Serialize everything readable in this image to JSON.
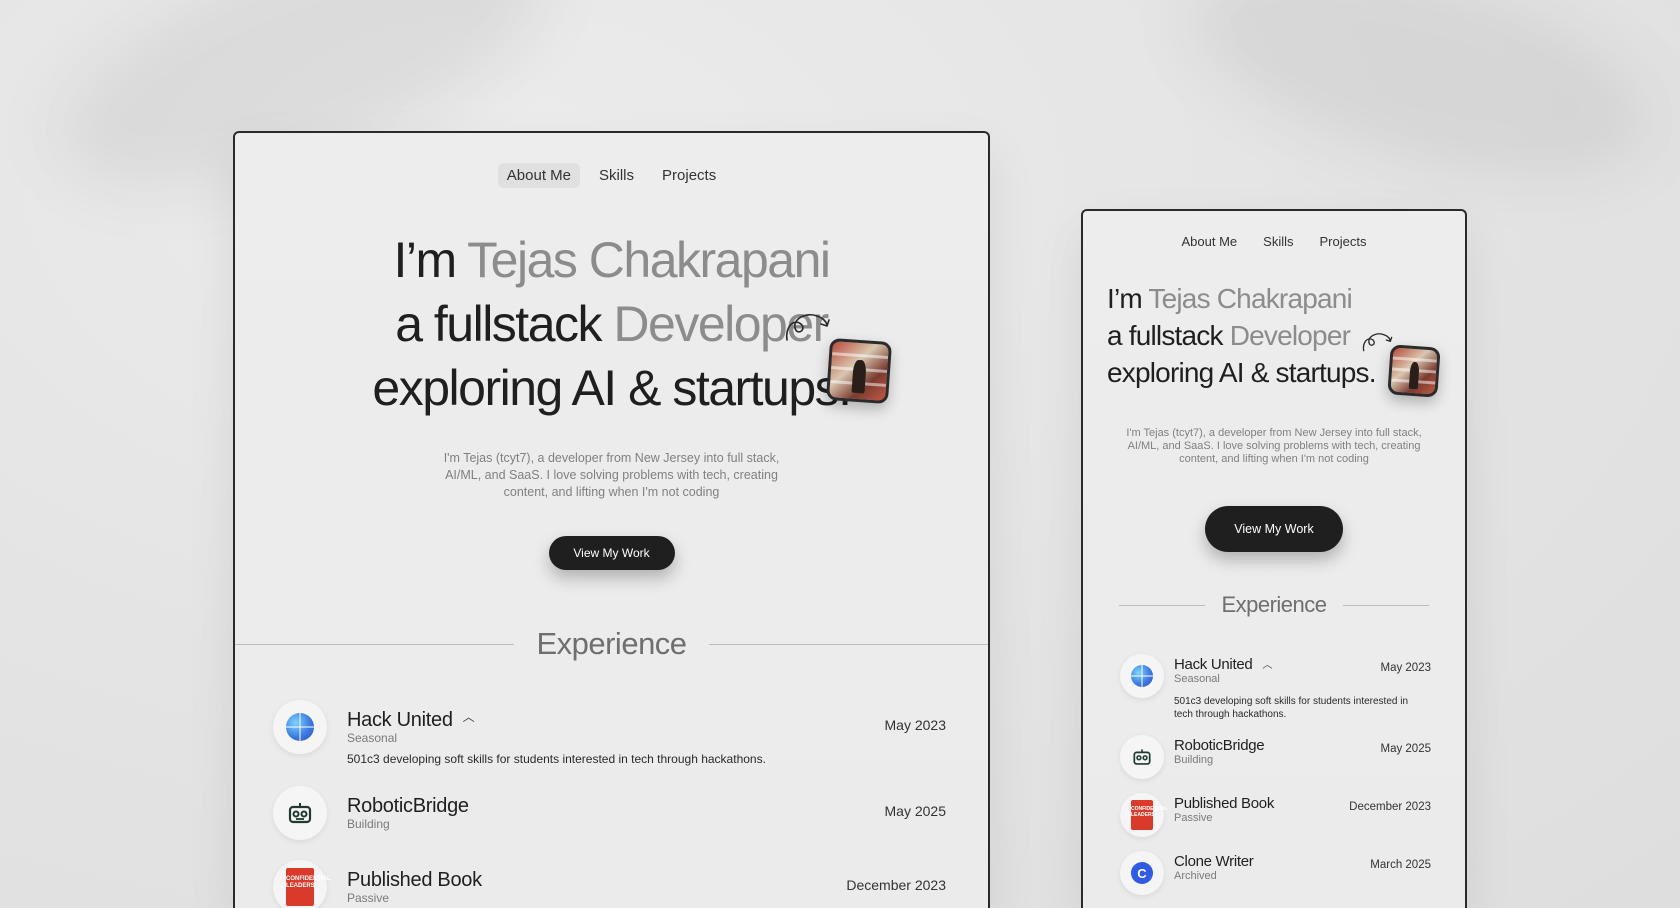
{
  "nav": [
    "About Me",
    "Skills",
    "Projects"
  ],
  "hero": {
    "line1_a": "I’m ",
    "line1_b": "Tejas Chakrapani",
    "line2_a": "a fullstack ",
    "line2_b": "Developer",
    "line3": "exploring AI & startups.",
    "bio": "I'm Tejas (tcyt7), a developer from New Jersey into full stack, AI/ML, and SaaS. I love solving problems with tech, creating content, and lifting when I'm not coding",
    "cta": "View My Work"
  },
  "experience": {
    "heading": "Experience",
    "items": [
      {
        "title": "Hack United",
        "sub": "Seasonal",
        "date": "May 2023",
        "desc": "501c3 developing soft skills for students interested in tech through hackathons.",
        "icon": "globe-icon"
      },
      {
        "title": "RoboticBridge",
        "sub": "Building",
        "date": "May 2025",
        "icon": "robot-icon"
      },
      {
        "title": "Published Book",
        "sub": "Passive",
        "date": "December 2023",
        "icon": "book-icon",
        "book_text": "CONFIDENTIAL LEADERS"
      },
      {
        "title": "Clone Writer",
        "sub": "Archived",
        "date": "March 2025",
        "icon": "clone-c-icon",
        "letter": "C"
      }
    ]
  },
  "colors": {
    "accent": "#1f1f1f",
    "muted": "#8c8c8c",
    "background": "#e6e6e6"
  }
}
